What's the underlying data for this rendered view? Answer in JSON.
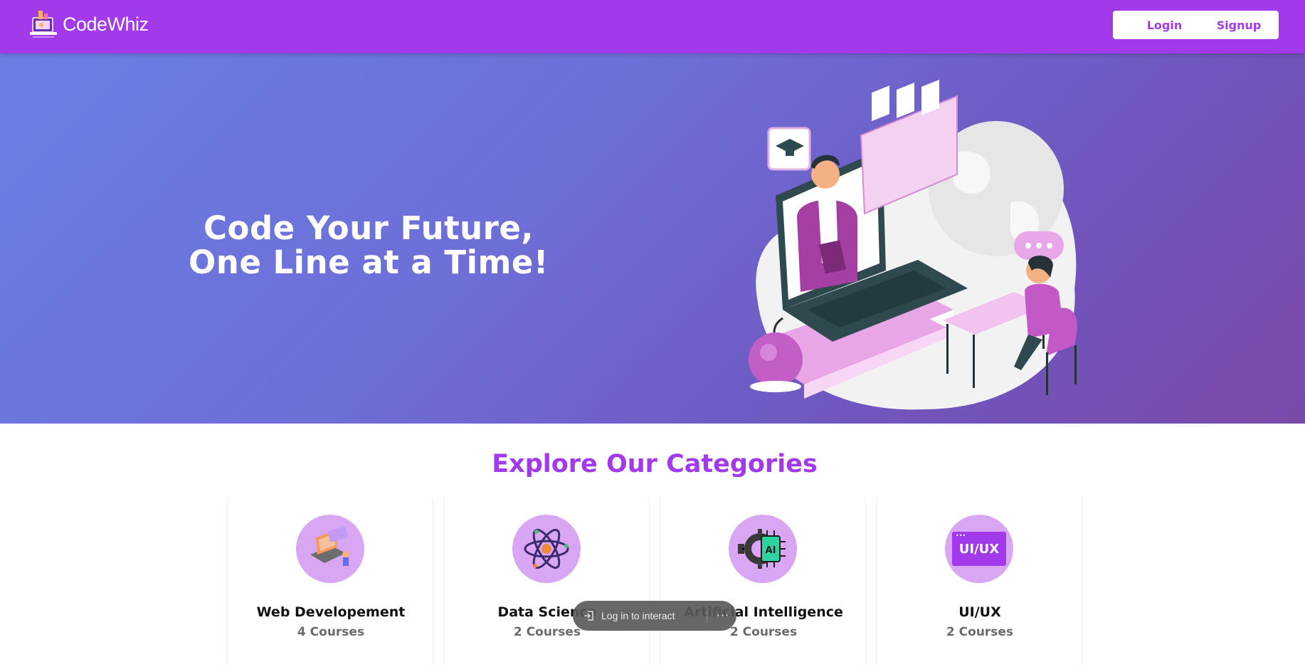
{
  "brand": {
    "name": "CodeWhiz",
    "logo_icon": "laptop-logo-icon"
  },
  "nav": {
    "login_label": "Login",
    "signup_label": "Signup"
  },
  "hero": {
    "title_line1": "Code Your Future,",
    "title_line2": "One Line at a Time!",
    "illustration": "online-learning-illustration"
  },
  "categories": {
    "heading": "Explore Our Categories",
    "items": [
      {
        "name": "Web Developement",
        "count": "4 Courses",
        "icon": "web-dev-icon"
      },
      {
        "name": "Data Science",
        "count": "2 Courses",
        "icon": "atom-icon"
      },
      {
        "name": "Artificial Intelligence",
        "count": "2 Courses",
        "icon": "ai-chip-icon"
      },
      {
        "name": "UI/UX",
        "count": "2 Courses",
        "icon": "ui-ux-icon",
        "icon_text": "UI/UX"
      }
    ]
  },
  "overlay": {
    "text": "Log in to interact",
    "more_glyph": "···"
  },
  "colors": {
    "primary": "#a239ea",
    "hero_start": "#6a7ee5",
    "hero_end": "#7a4aa8",
    "icon_bg": "#d8a6f3"
  }
}
